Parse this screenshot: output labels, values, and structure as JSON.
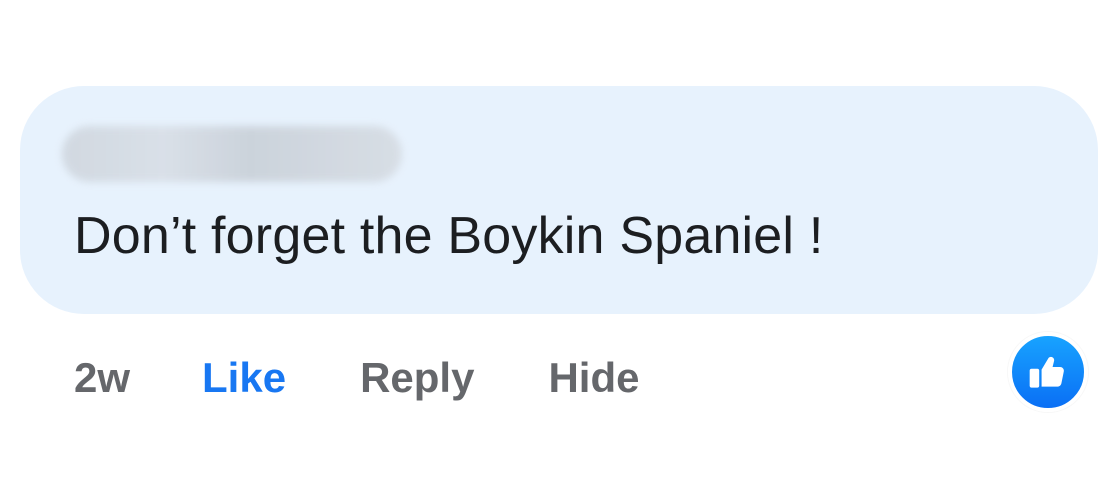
{
  "comment": {
    "author": "",
    "text": "Don’t forget the Boykin Spaniel !",
    "bubble_color": "#e7f2fd"
  },
  "actions": {
    "time": "2w",
    "like_label": "Like",
    "reply_label": "Reply",
    "hide_label": "Hide",
    "like_color": "#1877f2",
    "muted_color": "#65676b"
  },
  "reaction": {
    "icon": "thumbs-up-icon",
    "color": "#1877f2"
  }
}
